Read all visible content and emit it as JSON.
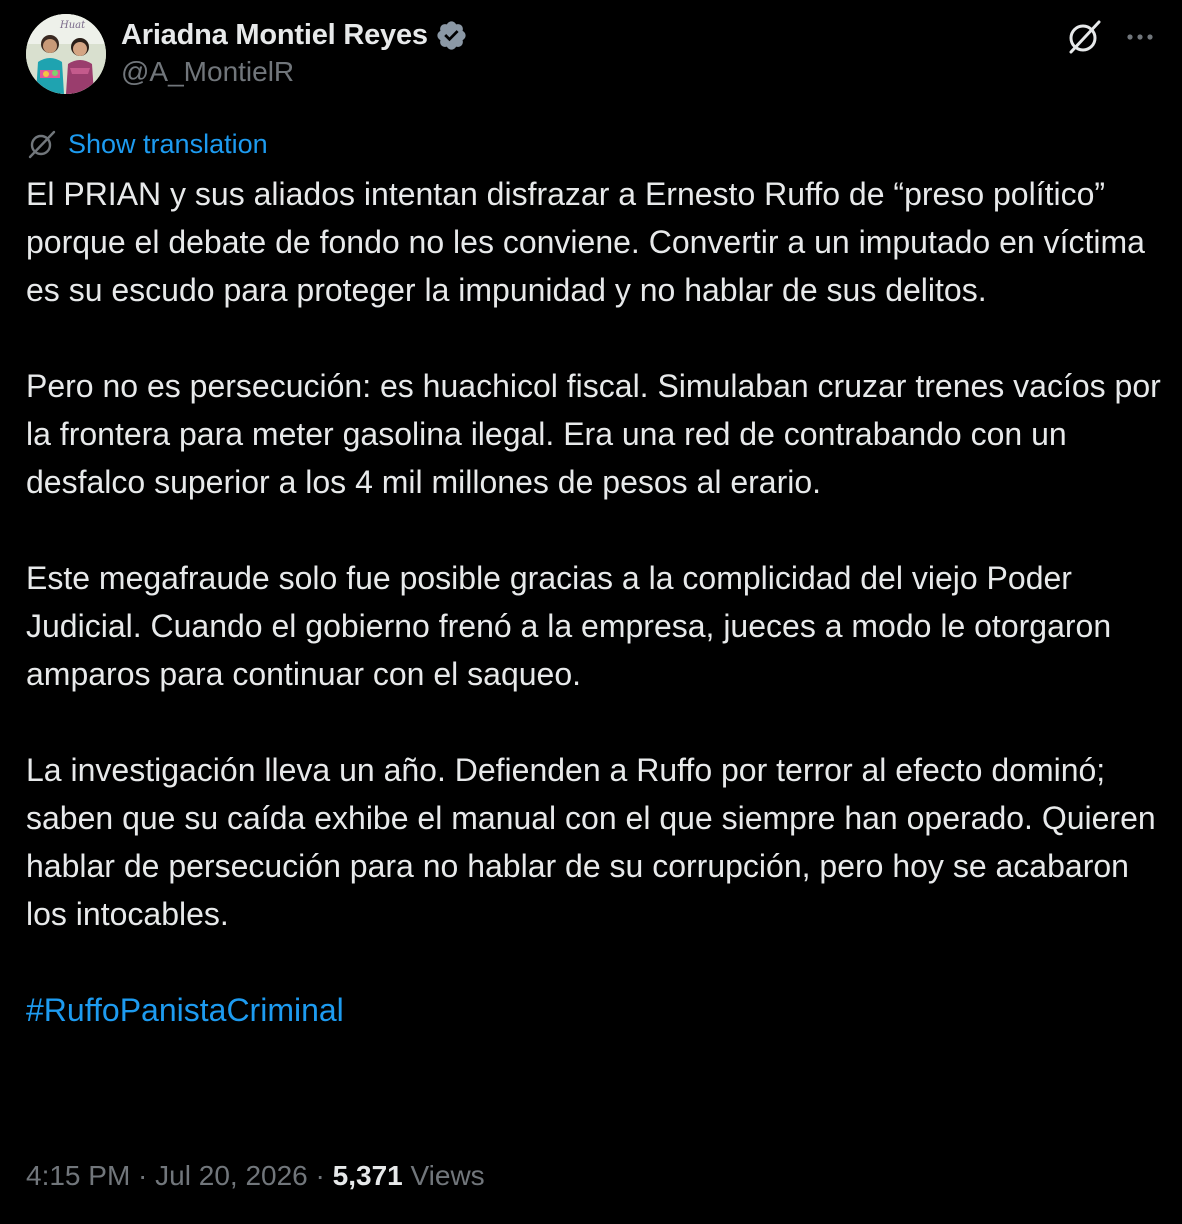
{
  "author": {
    "display_name": "Ariadna Montiel Reyes",
    "handle": "@A_MontielR",
    "avatar_caption": "Huat",
    "verified_icon": "verified-badge-icon"
  },
  "header_actions": {
    "grok_icon": "grok-icon",
    "more_icon": "more-dots-icon"
  },
  "translation": {
    "icon": "translate-icon",
    "label": "Show translation"
  },
  "tweet": {
    "paragraphs": [
      "El PRIAN y sus aliados intentan disfrazar a Ernesto Ruffo de “preso político” porque el debate de fondo no les conviene. Convertir a un imputado en víctima es su escudo para proteger la impunidad y no hablar de sus delitos.",
      "Pero no es persecución: es huachicol fiscal. Simulaban cruzar trenes vacíos por la frontera para meter gasolina ilegal. Era una red de contrabando con un desfalco superior a los 4 mil millones de pesos al erario.",
      "Este megafraude solo fue posible gracias a la complicidad del viejo Poder Judicial. Cuando el gobierno frenó a la empresa, jueces a modo le otorgaron amparos para continuar con el saqueo.",
      "La investigación lleva un año. Defienden a Ruffo por terror al efecto dominó; saben que su caída exhibe el manual con el que siempre han operado. Quieren hablar de persecución para no hablar de su corrupción, pero hoy se acabaron los intocables."
    ],
    "hashtag": "#RuffoPanistaCriminal"
  },
  "meta": {
    "time": "4:15 PM",
    "separator": " · ",
    "date": "Jul 20, 2026",
    "views_count": "5,371",
    "views_label": " Views"
  },
  "colors": {
    "background": "#000000",
    "text": "#e7e9ea",
    "secondary": "#71767b",
    "accent": "#1d9bf0"
  }
}
